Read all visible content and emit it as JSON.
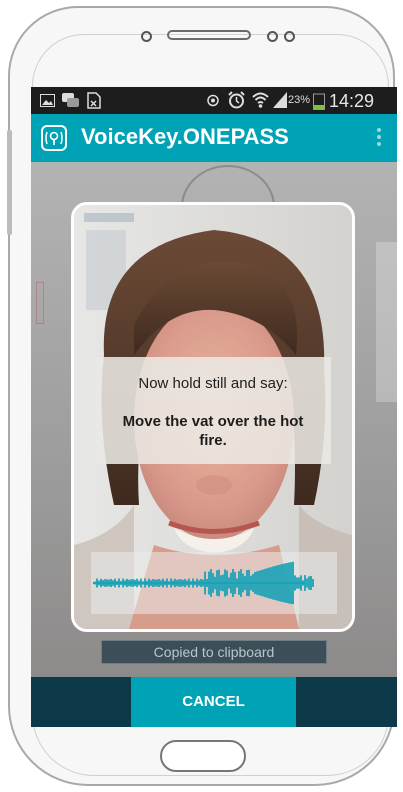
{
  "status_bar": {
    "battery_percent": "23%",
    "time": "14:29"
  },
  "app_bar": {
    "title": "VoiceKey.ONEPASS"
  },
  "prompt": {
    "instruction": "Now hold still and say:",
    "phrase_line1": "Move the vat over the hot",
    "phrase_line2": "fire."
  },
  "toast": {
    "text": "Copied to clipboard"
  },
  "buttons": {
    "cancel_label": "CANCEL"
  },
  "colors": {
    "accent": "#00a3b5",
    "status_bar": "#1d1d1d",
    "bottom_bar": "#0d3a49",
    "waveform": "#1aa3b6"
  },
  "icons": {
    "app": "voicekey-logo-icon",
    "overflow": "overflow-menu-icon"
  }
}
